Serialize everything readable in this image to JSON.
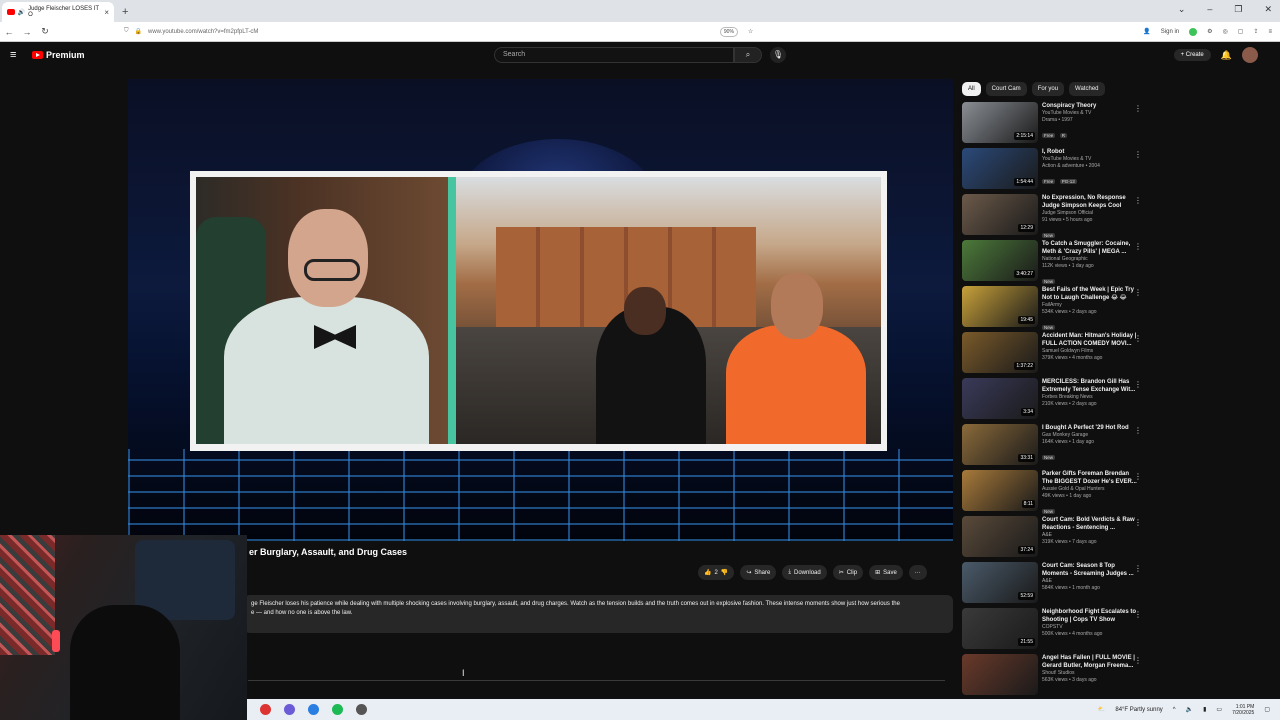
{
  "browser": {
    "tab_title": "Judge Fleischer LOSES IT O",
    "tab_close": "×",
    "new_tab": "+",
    "url": "www.youtube.com/watch?v=fm2pfpLT-cM",
    "zoom": "90%",
    "sign_in": "Sign in",
    "win_min": "⌄",
    "win_minimize": "–",
    "win_restore": "❐",
    "win_close": "✕"
  },
  "header": {
    "logo_text": "Premium",
    "search_placeholder": "Search",
    "create_label": "+ Create"
  },
  "video": {
    "title_visible": "er Burglary, Assault, and Drug Cases",
    "likes": "2",
    "share_label": "Share",
    "download_label": "Download",
    "clip_label": "Clip",
    "save_label": "Save",
    "more_label": "···",
    "description_line1": "ge Fleischer loses his patience while dealing with multiple shocking cases involving burglary, assault, and drug charges. Watch as the tension builds and the truth comes out in explosive fashion. These intense moments show just how serious the",
    "description_line2": "e — and how no one is above the law."
  },
  "sidebar": {
    "chips": [
      "All",
      "Court Cam",
      "For you",
      "Watched"
    ],
    "items": [
      {
        "title": "Conspiracy Theory",
        "channel": "YouTube Movies & TV",
        "meta": "Drama • 1997",
        "duration": "2:15:14",
        "badges": [
          "Free",
          "R"
        ],
        "color": "#8a8f95"
      },
      {
        "title": "I, Robot",
        "channel": "YouTube Movies & TV",
        "meta": "Action & adventure • 2004",
        "duration": "1:54:44",
        "badges": [
          "Free",
          "PG-13"
        ],
        "color": "#2b4a7a"
      },
      {
        "title": "No Expression, No Response Judge Simpson Keeps Cool",
        "channel": "Judge Simpson Official",
        "meta": "91 views • 5 hours ago",
        "duration": "12:29",
        "badges": [
          "New"
        ],
        "color": "#6c5a4a"
      },
      {
        "title": "To Catch a Smuggler: Cocaine, Meth & 'Crazy Pills' | MEGA ...",
        "channel": "National Geographic",
        "meta": "112K views • 1 day ago",
        "duration": "3:40:27",
        "badges": [
          "New"
        ],
        "color": "#4c7a3a"
      },
      {
        "title": "Best Fails of the Week | Epic Try Not to Laugh Challenge 😂 😂",
        "channel": "FailArmy",
        "meta": "534K views • 2 days ago",
        "duration": "19:45",
        "badges": [
          "New"
        ],
        "color": "#c8a13a"
      },
      {
        "title": "Accident Man: Hitman's Holiday | FULL ACTION COMEDY MOVI...",
        "channel": "Samuel Goldwyn Films",
        "meta": "379K views • 4 months ago",
        "duration": "1:37:22",
        "badges": [],
        "color": "#7a5a2a"
      },
      {
        "title": "MERCILESS: Brandon Gill Has Extremely Tense Exchange Wit...",
        "channel": "Forbes Breaking News",
        "meta": "210K views • 2 days ago",
        "duration": "3:34",
        "badges": [],
        "color": "#3a3a5a"
      },
      {
        "title": "I Bought A Perfect '29 Hot Rod",
        "channel": "Gas Monkey Garage",
        "meta": "164K views • 1 day ago",
        "duration": "33:31",
        "badges": [
          "New"
        ],
        "color": "#8a6a3a"
      },
      {
        "title": "Parker Gifts Foreman Brendan The BIGGEST Dozer He's EVER...",
        "channel": "Aussie Gold & Opal Hunters",
        "meta": "49K views • 1 day ago",
        "duration": "8:11",
        "badges": [
          "New"
        ],
        "color": "#a87a3a"
      },
      {
        "title": "Court Cam: Bold Verdicts & Raw Reactions - Sentencing ...",
        "channel": "A&E",
        "meta": "319K views • 7 days ago",
        "duration": "37:24",
        "badges": [],
        "color": "#5a4a3a"
      },
      {
        "title": "Court Cam: Season 8 Top Moments - Screaming Judges ...",
        "channel": "A&E",
        "meta": "584K views • 1 month ago",
        "duration": "52:59",
        "badges": [],
        "color": "#4a5a6a"
      },
      {
        "title": "Neighborhood Fight Escalates to Shooting | Cops TV Show",
        "channel": "COPSTV",
        "meta": "500K views • 4 months ago",
        "duration": "21:55",
        "badges": [],
        "color": "#3a3a3a"
      },
      {
        "title": "Angel Has Fallen | FULL MOVIE | Gerard Butler, Morgan Freema...",
        "channel": "Shout! Studios",
        "meta": "563K views • 3 days ago",
        "duration": "",
        "badges": [],
        "color": "#6a3a2a"
      }
    ]
  },
  "taskbar": {
    "weather": "84°F  Partly sunny",
    "time": "1:01 PM",
    "date": "7/20/2025"
  }
}
